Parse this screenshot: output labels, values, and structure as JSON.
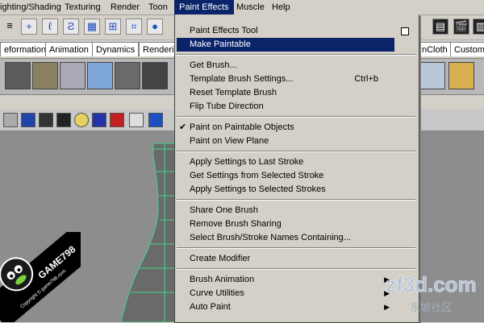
{
  "menubar": {
    "items": [
      "ighting/Shading",
      "Texturing",
      "Render",
      "Toon",
      "Paint Effects",
      "Muscle",
      "Help"
    ],
    "active_index": 4
  },
  "shelf_tabs": [
    "eformation",
    "Animation",
    "Dynamics",
    "Renderi",
    "nCloth",
    "Custom"
  ],
  "menu": {
    "items": [
      {
        "label": "Paint Effects Tool",
        "option_box": true
      },
      {
        "label": "Make Paintable",
        "highlighted": true
      },
      {
        "label": "Get Brush..."
      },
      {
        "label": "Template Brush Settings...",
        "shortcut": "Ctrl+b"
      },
      {
        "label": "Reset Template Brush"
      },
      {
        "label": "Flip Tube Direction"
      },
      {
        "label": "Paint on Paintable Objects",
        "checked": true
      },
      {
        "label": "Paint on View Plane"
      },
      {
        "label": "Apply Settings to Last Stroke"
      },
      {
        "label": "Get Settings from Selected Stroke"
      },
      {
        "label": "Apply Settings to Selected Strokes"
      },
      {
        "label": "Share One Brush"
      },
      {
        "label": "Remove Brush Sharing"
      },
      {
        "label": "Select Brush/Stroke Names Containing..."
      },
      {
        "label": "Create Modifier"
      },
      {
        "label": "Brush Animation",
        "submenu": true
      },
      {
        "label": "Curve Utilities",
        "submenu": true
      },
      {
        "label": "Auto Paint",
        "submenu": true
      }
    ]
  },
  "watermark": {
    "logo_text": "GAME798",
    "logo_sub": "Copyright © game798.com",
    "site_text": "zf3d.com",
    "site_sub": "东坡社区"
  },
  "colors": {
    "highlight": "#0a246a",
    "menu_bg": "#d4d0c8",
    "viewport_bg": "#8d8d8d",
    "wireframe": "#3fd68a"
  }
}
